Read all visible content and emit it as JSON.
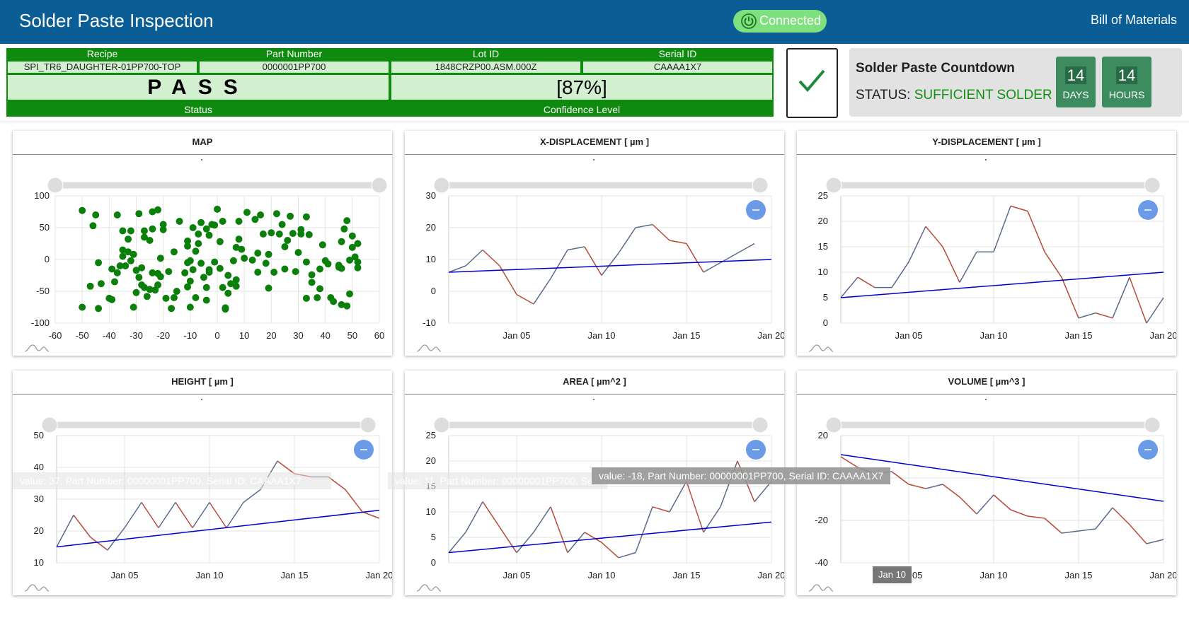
{
  "header": {
    "title": "Solder Paste Inspection",
    "connection_label": "Connected",
    "bom_label": "Bill of Materials"
  },
  "colors": {
    "header_bg": "#0a5d95",
    "pass_green": "#0e8a0e",
    "cell_green": "#d2efcf",
    "connected": "#7ee07e",
    "countdown_box": "#3c8c60",
    "trend": "#0000cc",
    "series_up": "#5a6a8a",
    "series_down": "#b84a3a",
    "scatter": "#0a7f0a",
    "zoom_btn": "#6b9be6"
  },
  "inspection": {
    "recipe_label": "Recipe",
    "recipe": "SPI_TR6_DAUGHTER-01PP700-TOP",
    "part_label": "Part Number",
    "part": "0000001PP700",
    "lot_label": "Lot ID",
    "lot": "1848CRZP00.ASM.000Z",
    "serial_label": "Serial ID",
    "serial": "CAAAA1X7",
    "status": "PASS",
    "status_label": "Status",
    "confidence": "[87%]",
    "confidence_label": "Confidence Level"
  },
  "countdown": {
    "title": "Solder Paste Countdown",
    "status_label": "STATUS:",
    "status_value": "SUFFICIENT SOLDER",
    "days": "14",
    "days_label": "DAYS",
    "hours": "14",
    "hours_label": "HOURS"
  },
  "tooltips": {
    "area": "value: -18, Part Number: 00000001PP700, Serial ID: CAAAA1X7",
    "height_faint": "value: 37, Part Number: 00000001PP700, Serial ID: CAAAA1X7",
    "area_faint": "value: 11, Part Number: 00000001PP700, Se",
    "volume_x": "Jan 10"
  },
  "chart_data": [
    {
      "type": "scatter",
      "title": "MAP",
      "xlim": [
        -60,
        60
      ],
      "ylim": [
        -100,
        100
      ],
      "xticks": [
        -60,
        -50,
        -40,
        -30,
        -20,
        -10,
        0,
        10,
        20,
        30,
        40,
        50,
        60
      ],
      "yticks": [
        -100,
        -50,
        0,
        50,
        100
      ],
      "points": [
        [
          -50,
          77
        ],
        [
          -45,
          70
        ],
        [
          -46,
          53
        ],
        [
          -44,
          -5
        ],
        [
          -50,
          -75
        ],
        [
          -47,
          -42
        ],
        [
          -43,
          -38
        ],
        [
          -39,
          -15
        ],
        [
          -37,
          -21
        ],
        [
          -40,
          -61
        ],
        [
          -39,
          -63
        ],
        [
          -44,
          -77
        ],
        [
          -38,
          -35
        ],
        [
          -36,
          -10
        ],
        [
          -35,
          5
        ],
        [
          -34,
          -10
        ],
        [
          -33,
          12
        ],
        [
          -37,
          70
        ],
        [
          -35,
          45
        ],
        [
          -35,
          15
        ],
        [
          -32,
          45
        ],
        [
          -31,
          8
        ],
        [
          -33,
          32
        ],
        [
          -32,
          -2
        ],
        [
          -30,
          -17
        ],
        [
          -29,
          -28
        ],
        [
          -31,
          -75
        ],
        [
          -30,
          -52
        ],
        [
          -29,
          72
        ],
        [
          -27,
          45
        ],
        [
          -27,
          35
        ],
        [
          -28,
          -13
        ],
        [
          -27,
          -44
        ],
        [
          -26,
          -58
        ],
        [
          -28,
          -40
        ],
        [
          -25,
          30
        ],
        [
          -24,
          75
        ],
        [
          -24,
          48
        ],
        [
          -22,
          78
        ],
        [
          -23,
          -48
        ],
        [
          -25,
          -47
        ],
        [
          -24,
          -21
        ],
        [
          -22,
          -40
        ],
        [
          -21,
          -27
        ],
        [
          -22,
          -22
        ],
        [
          -20,
          55
        ],
        [
          -20,
          47
        ],
        [
          -21,
          2
        ],
        [
          -19,
          -61
        ],
        [
          -18,
          -19
        ],
        [
          -17,
          -77
        ],
        [
          -16,
          -60
        ],
        [
          -15,
          -50
        ],
        [
          -16,
          12
        ],
        [
          -14,
          60
        ],
        [
          -11,
          29
        ],
        [
          -11,
          21
        ],
        [
          -12,
          -21
        ],
        [
          -11,
          -43
        ],
        [
          -10,
          -34
        ],
        [
          -10,
          -75
        ],
        [
          -9,
          50
        ],
        [
          -9,
          -16
        ],
        [
          -11,
          -5
        ],
        [
          -10,
          -2
        ],
        [
          -8,
          -60
        ],
        [
          -8,
          13
        ],
        [
          -7,
          40
        ],
        [
          -7,
          25
        ],
        [
          -6,
          58
        ],
        [
          -6,
          -6
        ],
        [
          -4,
          48
        ],
        [
          -4,
          -44
        ],
        [
          -5,
          -28
        ],
        [
          -4,
          -64
        ],
        [
          -3,
          38
        ],
        [
          -3,
          -16
        ],
        [
          -3,
          -20
        ],
        [
          -2,
          55
        ],
        [
          -1,
          54
        ],
        [
          -1,
          -4
        ],
        [
          0,
          79
        ],
        [
          1,
          28
        ],
        [
          1,
          -14
        ],
        [
          2,
          -44
        ],
        [
          3,
          -76
        ],
        [
          3,
          -78
        ],
        [
          2,
          60
        ],
        [
          4,
          -53
        ],
        [
          5,
          -38
        ],
        [
          4,
          -25
        ],
        [
          6,
          -2
        ],
        [
          7,
          19
        ],
        [
          7,
          -42
        ],
        [
          7,
          -32
        ],
        [
          8,
          60
        ],
        [
          8,
          32
        ],
        [
          9,
          16
        ],
        [
          10,
          2
        ],
        [
          11,
          74
        ],
        [
          13,
          -1
        ],
        [
          14,
          63
        ],
        [
          15,
          -20
        ],
        [
          15,
          10
        ],
        [
          16,
          70
        ],
        [
          17,
          40
        ],
        [
          18,
          -6
        ],
        [
          19,
          -45
        ],
        [
          19,
          8
        ],
        [
          20,
          42
        ],
        [
          21,
          -20
        ],
        [
          22,
          72
        ],
        [
          23,
          40
        ],
        [
          24,
          55
        ],
        [
          25,
          20
        ],
        [
          25,
          -15
        ],
        [
          26,
          30
        ],
        [
          27,
          68
        ],
        [
          28,
          41
        ],
        [
          29,
          -19
        ],
        [
          30,
          11
        ],
        [
          31,
          47
        ],
        [
          31,
          40
        ],
        [
          33,
          67
        ],
        [
          33,
          -61
        ],
        [
          33,
          -4
        ],
        [
          34,
          39
        ],
        [
          35,
          -36
        ],
        [
          35,
          -24
        ],
        [
          37,
          -60
        ],
        [
          38,
          -46
        ],
        [
          38,
          -15
        ],
        [
          39,
          23
        ],
        [
          40,
          -2
        ],
        [
          41,
          -7
        ],
        [
          42,
          -60
        ],
        [
          43,
          -66
        ],
        [
          45,
          -9
        ],
        [
          45,
          -12
        ],
        [
          46,
          28
        ],
        [
          46,
          -14
        ],
        [
          46,
          -71
        ],
        [
          47,
          48
        ],
        [
          48,
          -73
        ],
        [
          48,
          61
        ],
        [
          49,
          -1
        ],
        [
          49,
          -54
        ],
        [
          50,
          19
        ],
        [
          50,
          37
        ],
        [
          51,
          4
        ],
        [
          52,
          -4
        ],
        [
          52,
          -13
        ],
        [
          52,
          25
        ]
      ]
    },
    {
      "type": "line",
      "title": "X-DISPLACEMENT [ µm ]",
      "ylim": [
        -10,
        30
      ],
      "yticks": [
        -10,
        0,
        10,
        20,
        30
      ],
      "xticks": [
        "Jan 05",
        "Jan 10",
        "Jan 15",
        "Jan 20"
      ],
      "x_start_day": 1,
      "values": [
        6,
        8,
        13,
        8,
        -1,
        -4,
        4,
        13,
        14,
        5,
        12,
        20,
        21,
        16,
        15,
        6,
        9,
        12,
        15
      ],
      "trend": [
        6,
        10
      ]
    },
    {
      "type": "line",
      "title": "Y-DISPLACEMENT [ µm ]",
      "ylim": [
        0,
        25
      ],
      "yticks": [
        0,
        5,
        10,
        15,
        20,
        25
      ],
      "xticks": [
        "Jan 05",
        "Jan 10",
        "Jan 15",
        "Jan 20"
      ],
      "x_start_day": 1,
      "values": [
        5,
        9,
        7,
        7,
        12,
        19,
        15,
        8,
        14,
        14,
        23,
        22,
        14,
        9,
        1,
        2,
        1,
        9,
        0,
        5
      ],
      "trend": [
        5,
        10
      ]
    },
    {
      "type": "line",
      "title": "HEIGHT [ µm ]",
      "ylim": [
        10,
        50
      ],
      "yticks": [
        10,
        20,
        30,
        40,
        50
      ],
      "xticks": [
        "Jan 05",
        "Jan 10",
        "Jan 15",
        "Jan 20"
      ],
      "x_start_day": 1,
      "values": [
        15,
        25,
        18,
        14,
        21,
        29,
        21,
        29,
        21,
        29,
        21,
        29,
        33,
        42,
        38,
        37,
        37,
        33,
        26,
        24
      ],
      "trend": [
        15,
        26.5
      ]
    },
    {
      "type": "line",
      "title": "AREA [ µm^2 ]",
      "ylim": [
        0,
        25
      ],
      "yticks": [
        0,
        5,
        10,
        15,
        20,
        25
      ],
      "xticks": [
        "Jan 05",
        "Jan 10",
        "Jan 15",
        "Jan 20"
      ],
      "x_start_day": 1,
      "values": [
        2,
        6,
        12,
        7,
        2,
        6,
        11,
        2,
        6,
        4,
        1,
        2,
        11,
        10,
        16,
        6,
        11,
        20,
        12,
        16
      ],
      "trend": [
        2,
        8
      ]
    },
    {
      "type": "line",
      "title": "VOLUME [ µm^3 ]",
      "ylim": [
        -40,
        20
      ],
      "yticks": [
        -40,
        -20,
        0,
        20
      ],
      "xticks": [
        "Jan 05",
        "Jan 10",
        "Jan 15",
        "Jan 20"
      ],
      "x_start_day": 1,
      "values": [
        10,
        5,
        2,
        3,
        -3,
        -5,
        -3,
        -9,
        -17,
        -8,
        -15,
        -18,
        -19,
        -26,
        -25,
        -24,
        -14,
        -22,
        -31,
        -29
      ],
      "trend": [
        11,
        -11
      ]
    }
  ]
}
